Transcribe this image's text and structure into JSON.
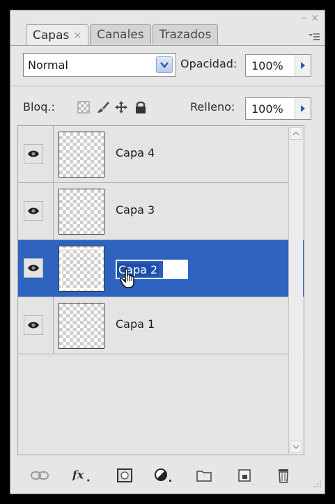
{
  "window": {
    "minimize": "–",
    "close": "×"
  },
  "tabs": [
    {
      "label": "Capas",
      "close": "×",
      "active": true
    },
    {
      "label": "Canales",
      "active": false
    },
    {
      "label": "Trazados",
      "active": false
    }
  ],
  "blend_mode": {
    "value": "Normal"
  },
  "opacity": {
    "label": "Opacidad:",
    "value": "100%"
  },
  "lock": {
    "label": "Bloq.:"
  },
  "fill": {
    "label": "Relleno:",
    "value": "100%"
  },
  "layers": [
    {
      "name": "Capa 4",
      "visible": true,
      "selected": false
    },
    {
      "name": "Capa 3",
      "visible": true,
      "selected": false
    },
    {
      "name": "Capa 2",
      "visible": true,
      "selected": true,
      "editing": true
    },
    {
      "name": "Capa 1",
      "visible": true,
      "selected": false
    }
  ],
  "bottom_tools": [
    "link-icon",
    "fx-icon",
    "mask-icon",
    "adjustment-icon",
    "folder-icon",
    "new-layer-icon",
    "trash-icon"
  ],
  "colors": {
    "selection": "#2e63c0",
    "panel": "#e6e6e6",
    "accent_arrow": "#2a56b8"
  }
}
